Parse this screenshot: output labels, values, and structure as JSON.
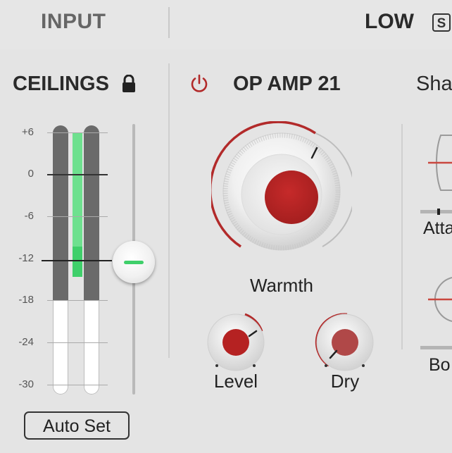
{
  "header": {
    "input_label": "INPUT",
    "band_label": "LOW",
    "solo_label": "S"
  },
  "ceilings": {
    "title": "CEILINGS",
    "scale": [
      "+6",
      "0",
      "-6",
      "-12",
      "-18",
      "-24",
      "-30"
    ],
    "ceiling_db": -12.5,
    "auto_set_label": "Auto Set"
  },
  "module": {
    "title": "OP AMP 21",
    "power_on": true,
    "knobs": {
      "warmth": {
        "label": "Warmth"
      },
      "level": {
        "label": "Level"
      },
      "dry": {
        "label": "Dry"
      }
    }
  },
  "shape": {
    "title": "Sha",
    "attack_label": "Atta",
    "body_label": "Bo"
  },
  "colors": {
    "accent_red": "#b22a2a",
    "meter_green": "#3fcf6a",
    "meter_green_light": "#6ee08e",
    "background": "#e4e4e4"
  }
}
